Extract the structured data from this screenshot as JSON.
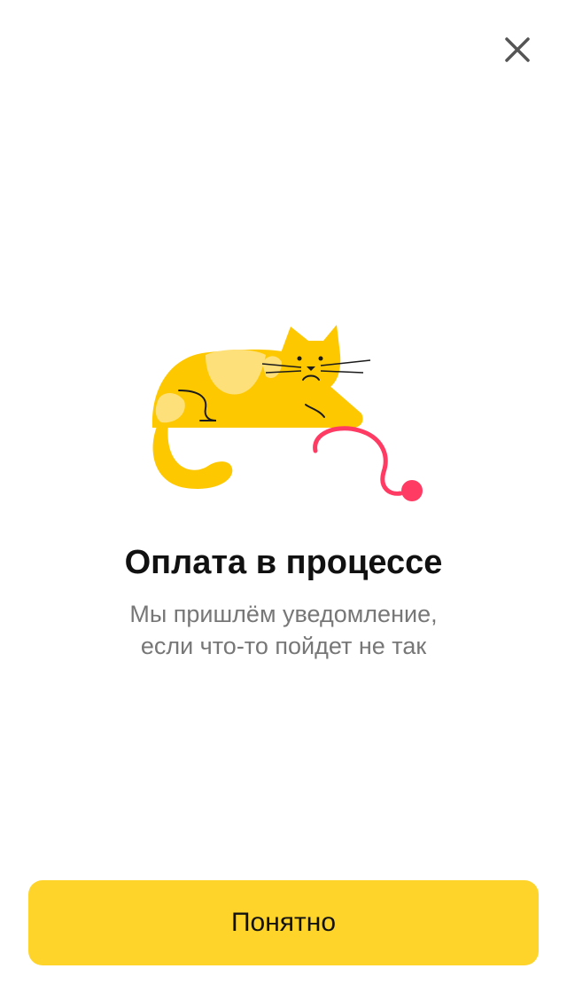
{
  "header": {
    "close_icon": "close-icon"
  },
  "illustration": {
    "icon": "cat-with-yarn-illustration",
    "colors": {
      "cat_body": "#fdc800",
      "cat_patch": "#fee07a",
      "yarn": "#ff3b63",
      "outline": "#1a1a1a"
    }
  },
  "content": {
    "title": "Оплата в процессе",
    "subtitle_line1": "Мы пришлём уведомление,",
    "subtitle_line2": "если что-то пойдет не так"
  },
  "footer": {
    "button_label": "Понятно",
    "button_color": "#fed42b"
  }
}
